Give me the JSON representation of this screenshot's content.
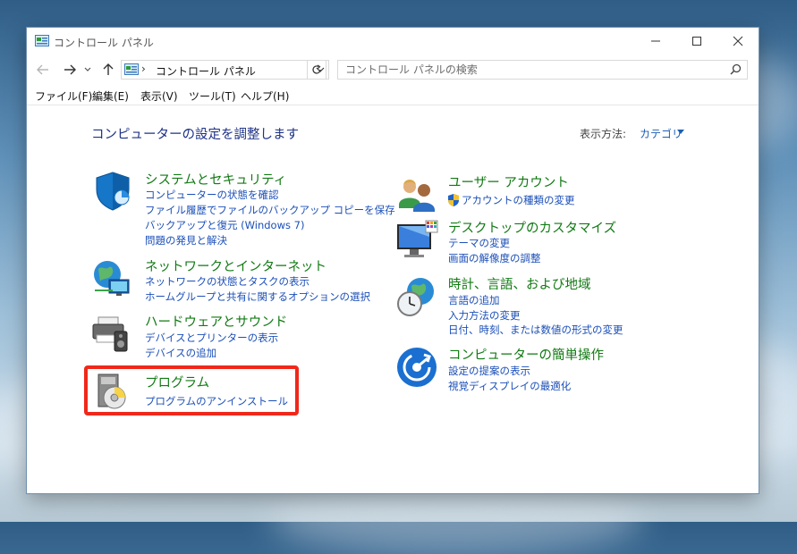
{
  "window": {
    "title": "コントロール パネル",
    "controls": {
      "minimize": "—",
      "maximize": "☐",
      "close": "✕"
    }
  },
  "address_bar": {
    "separator": "›",
    "path": "コントロール パネル",
    "search_placeholder": "コントロール パネルの検索"
  },
  "menu": [
    "ファイル(F)",
    "編集(E)",
    "表示(V)",
    "ツール(T)",
    "ヘルプ(H)"
  ],
  "content": {
    "heading": "コンピューターの設定を調整します",
    "view_by_label": "表示方法:",
    "view_by_value": "カテゴリ"
  },
  "categories": [
    {
      "title": "システムとセキュリティ",
      "icon": "shield-icon",
      "links": [
        "コンピューターの状態を確認",
        "ファイル履歴でファイルのバックアップ コピーを保存",
        "バックアップと復元 (Windows 7)",
        "問題の発見と解決"
      ]
    },
    {
      "title": "ネットワークとインターネット",
      "icon": "network-globe-icon",
      "links": [
        "ネットワークの状態とタスクの表示",
        "ホームグループと共有に関するオプションの選択"
      ]
    },
    {
      "title": "ハードウェアとサウンド",
      "icon": "printer-speaker-icon",
      "links": [
        "デバイスとプリンターの表示",
        "デバイスの追加"
      ]
    },
    {
      "title": "プログラム",
      "icon": "programs-disc-icon",
      "links": [
        "プログラムのアンインストール"
      ]
    },
    {
      "title": "ユーザー アカウント",
      "icon": "users-icon",
      "links": [
        "アカウントの種類の変更"
      ]
    },
    {
      "title": "デスクトップのカスタマイズ",
      "icon": "desktop-monitor-icon",
      "links": [
        "テーマの変更",
        "画面の解像度の調整"
      ]
    },
    {
      "title": "時計、言語、および地域",
      "icon": "clock-globe-icon",
      "links": [
        "言語の追加",
        "入力方法の変更",
        "日付、時刻、または数値の形式の変更"
      ]
    },
    {
      "title": "コンピューターの簡単操作",
      "icon": "ease-of-access-icon",
      "links": [
        "設定の提案の表示",
        "視覚ディスプレイの最適化"
      ]
    }
  ],
  "colors": {
    "heading": "#1e3287",
    "category_title": "#117a13",
    "link": "#1b4fb8",
    "highlight": "#f0281a"
  }
}
